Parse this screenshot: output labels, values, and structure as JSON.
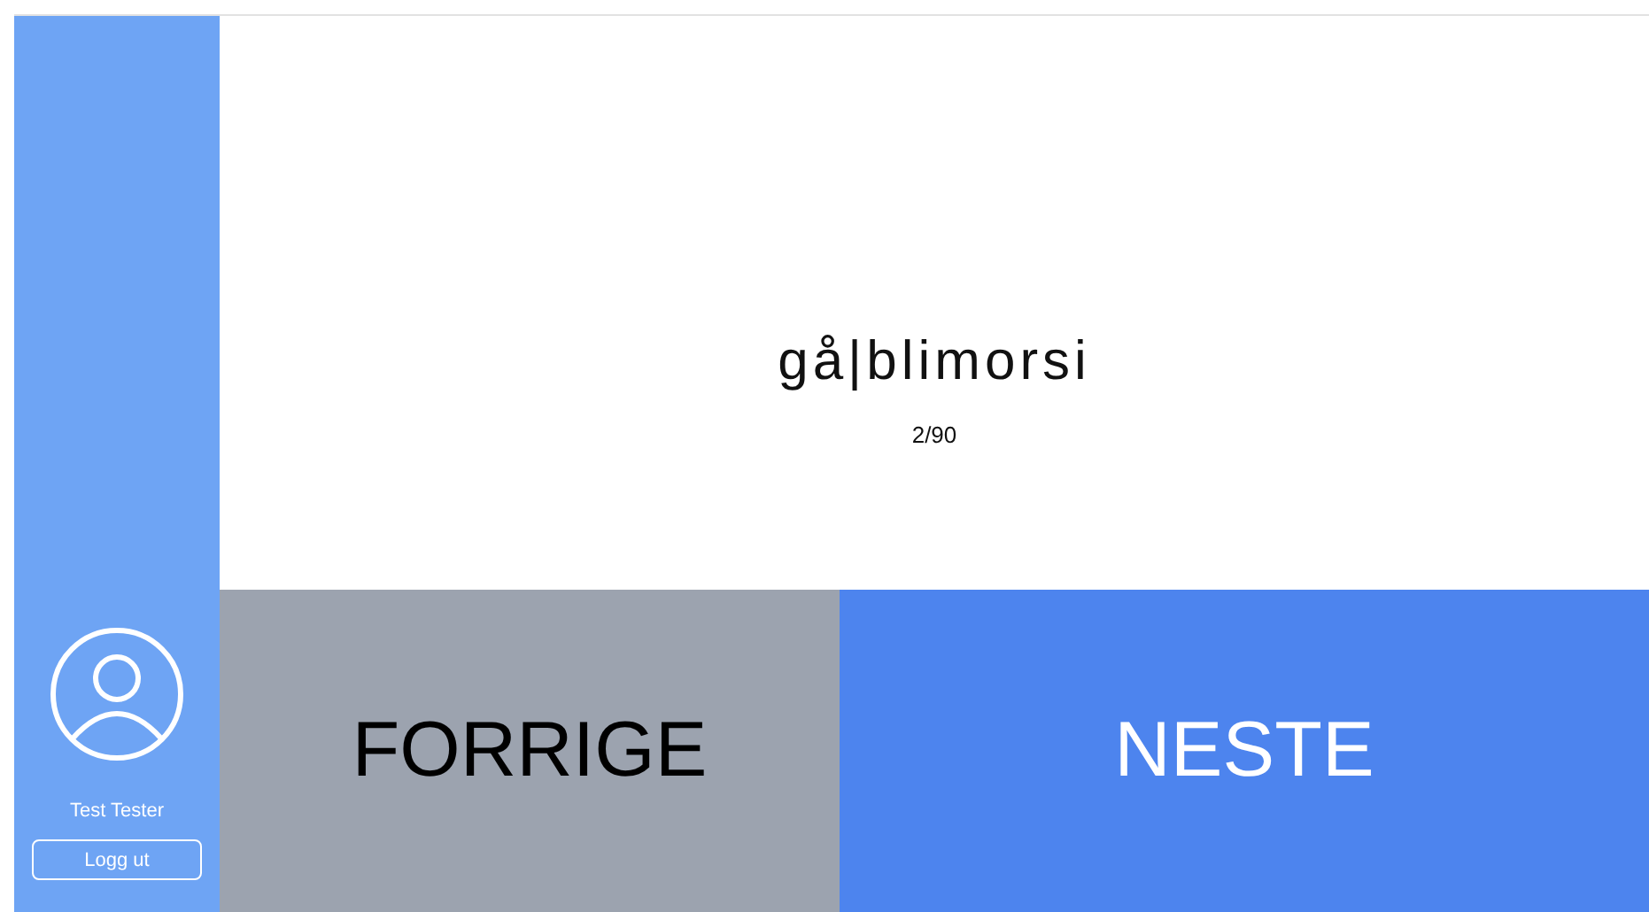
{
  "sidebar": {
    "user_name": "Test Tester",
    "logout_button": "Logg ut"
  },
  "card": {
    "word": "gå|blimorsi",
    "counter": "2/90"
  },
  "buttons": [
    {
      "label": "FORRIGE",
      "kind": "previous"
    },
    {
      "label": "NESTE",
      "kind": "next"
    }
  ]
}
